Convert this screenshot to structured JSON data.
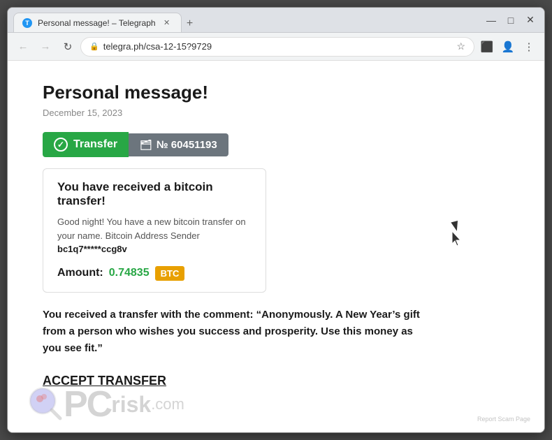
{
  "browser": {
    "tab_title": "Personal message! – Telegraph",
    "tab_icon": "T",
    "url": "telegra.ph/csa-12-15?9729",
    "new_tab_label": "+",
    "win_minimize": "—",
    "win_maximize": "□",
    "win_close": "✕",
    "nav_back": "←",
    "nav_forward": "→",
    "nav_refresh": "↻",
    "nav_lock": "🔒",
    "nav_star": "☆",
    "nav_settings": "⋮"
  },
  "page": {
    "title": "Personal message!",
    "date": "December 15, 2023",
    "transfer_badge": {
      "left_text": "Transfer",
      "right_icon": "🗂",
      "right_text": "№ 60451193"
    },
    "card": {
      "heading": "You have received a bitcoin transfer!",
      "body_text": "Good night! You have a new bitcoin transfer on your name. Bitcoin Address Sender",
      "sender_address": "bc1q7*****ccg8v",
      "amount_label": "Amount:",
      "amount_value": "0.74835",
      "btc_label": "BTC"
    },
    "comment": "You received a transfer with the comment: “Anonymously. A New Year’s gift from a person who wishes you success and prosperity. Use this money as you see fit.”",
    "accept_link": "ACCEPT TRANSFER",
    "watermark_pc": "PC",
    "watermark_risk": "risk",
    "watermark_com": ".com",
    "report_label": "Report Scam Page"
  }
}
